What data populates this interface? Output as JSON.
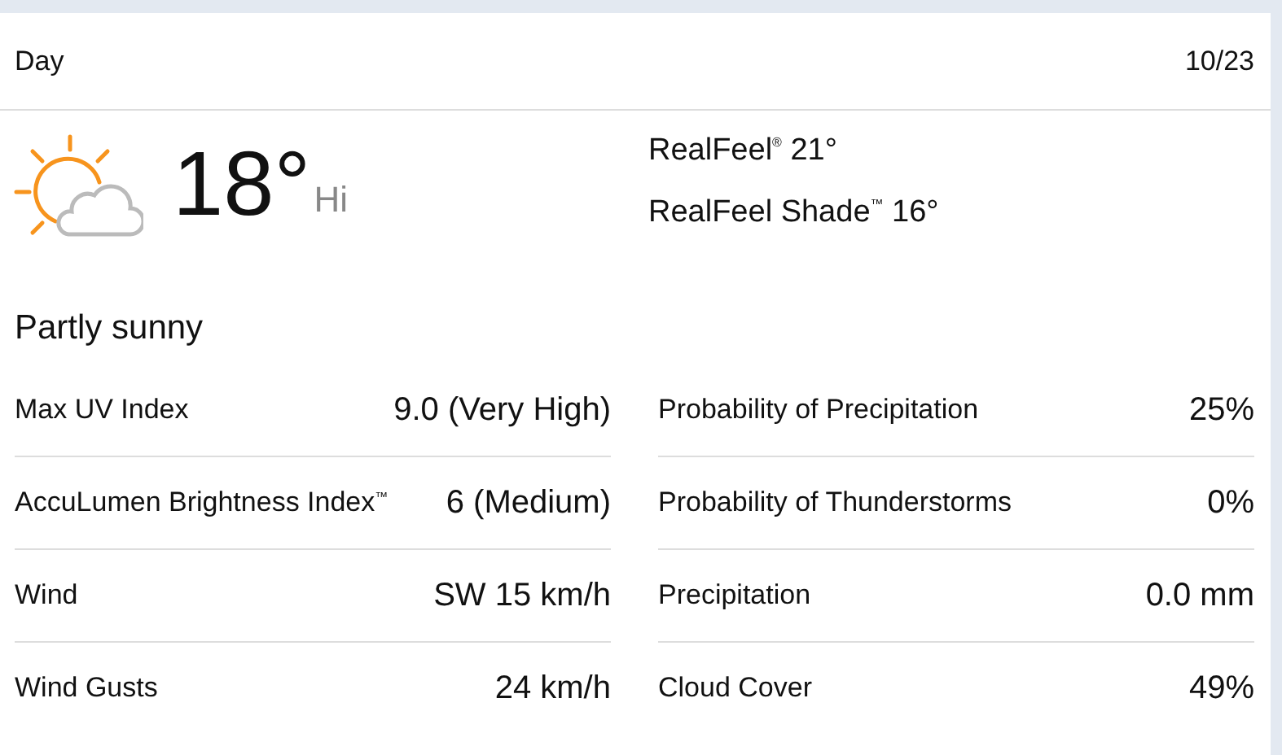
{
  "header": {
    "title": "Day",
    "date": "10/23"
  },
  "current": {
    "temperature": "18°",
    "temperature_label": "Hi",
    "realfeel": "RealFeel$^{®}$ 21°",
    "realfeel_shade": "RealFeel Shade$^{™}$ 16°",
    "phrase": "Partly sunny"
  },
  "details": [
    {
      "label": "Max UV Index",
      "value": "9.0 (Very High)"
    },
    {
      "label": "Probability of Precipitation",
      "value": "25%"
    },
    {
      "label": "AccuLumen Brightness Index$^{™}$",
      "value": "6 (Medium)"
    },
    {
      "label": "Probability of Thunderstorms",
      "value": "0%"
    },
    {
      "label": "Wind",
      "value": "SW 15 km/h"
    },
    {
      "label": "Precipitation",
      "value": "0.0 mm"
    },
    {
      "label": "Wind Gusts",
      "value": "24 km/h"
    },
    {
      "label": "Cloud Cover",
      "value": "49%"
    }
  ]
}
